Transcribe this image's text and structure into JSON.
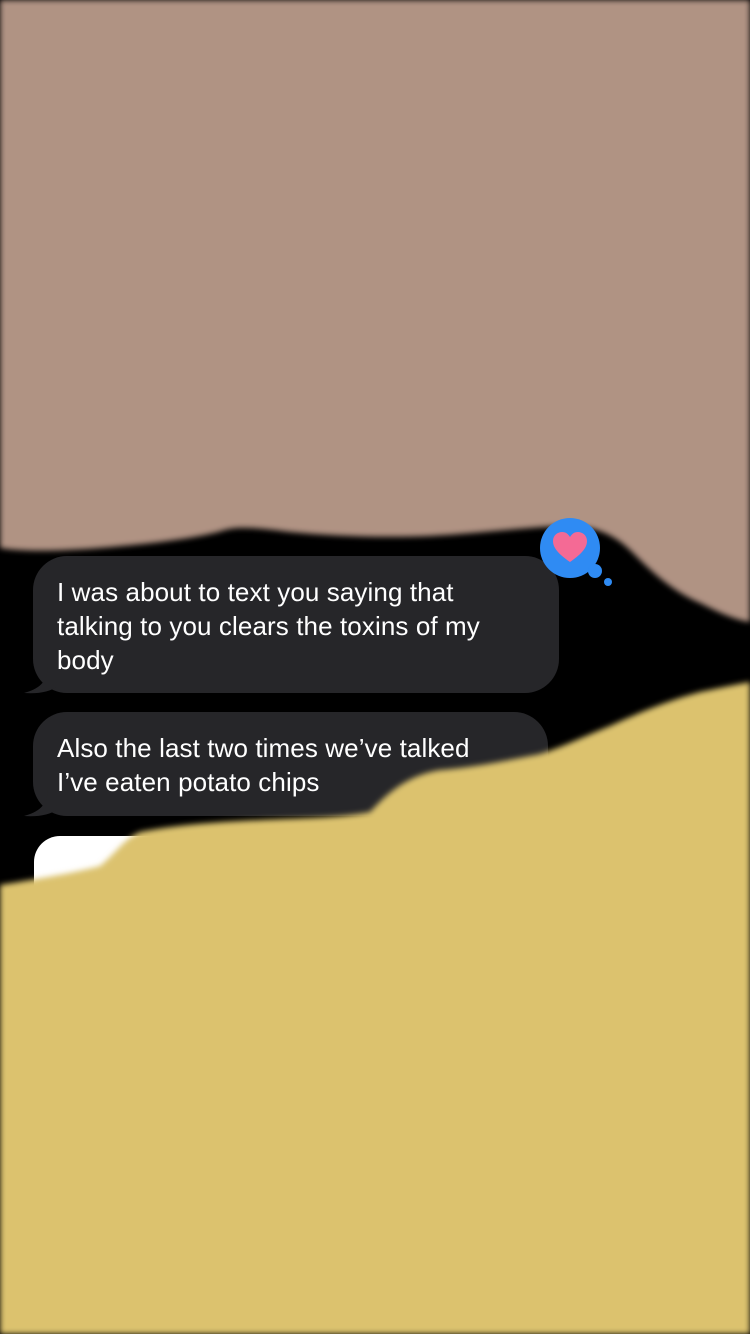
{
  "conversation": {
    "messages": [
      {
        "direction": "incoming",
        "lines": [
          "I was about to text you saying that",
          "talking to you clears the toxins of my",
          "body"
        ],
        "reaction": {
          "type": "heart",
          "icon": "heart-icon"
        }
      },
      {
        "direction": "incoming",
        "lines": [
          "Also the last two times we’ve talked",
          "I’ve eaten potato chips"
        ]
      }
    ]
  },
  "colors": {
    "background": "#000000",
    "incoming_bubble": "#262629",
    "reaction_bubble": "#2f8bf3",
    "heart": "#f46a95",
    "redaction_top": "#b09383",
    "redaction_bottom": "#dcc26e"
  }
}
